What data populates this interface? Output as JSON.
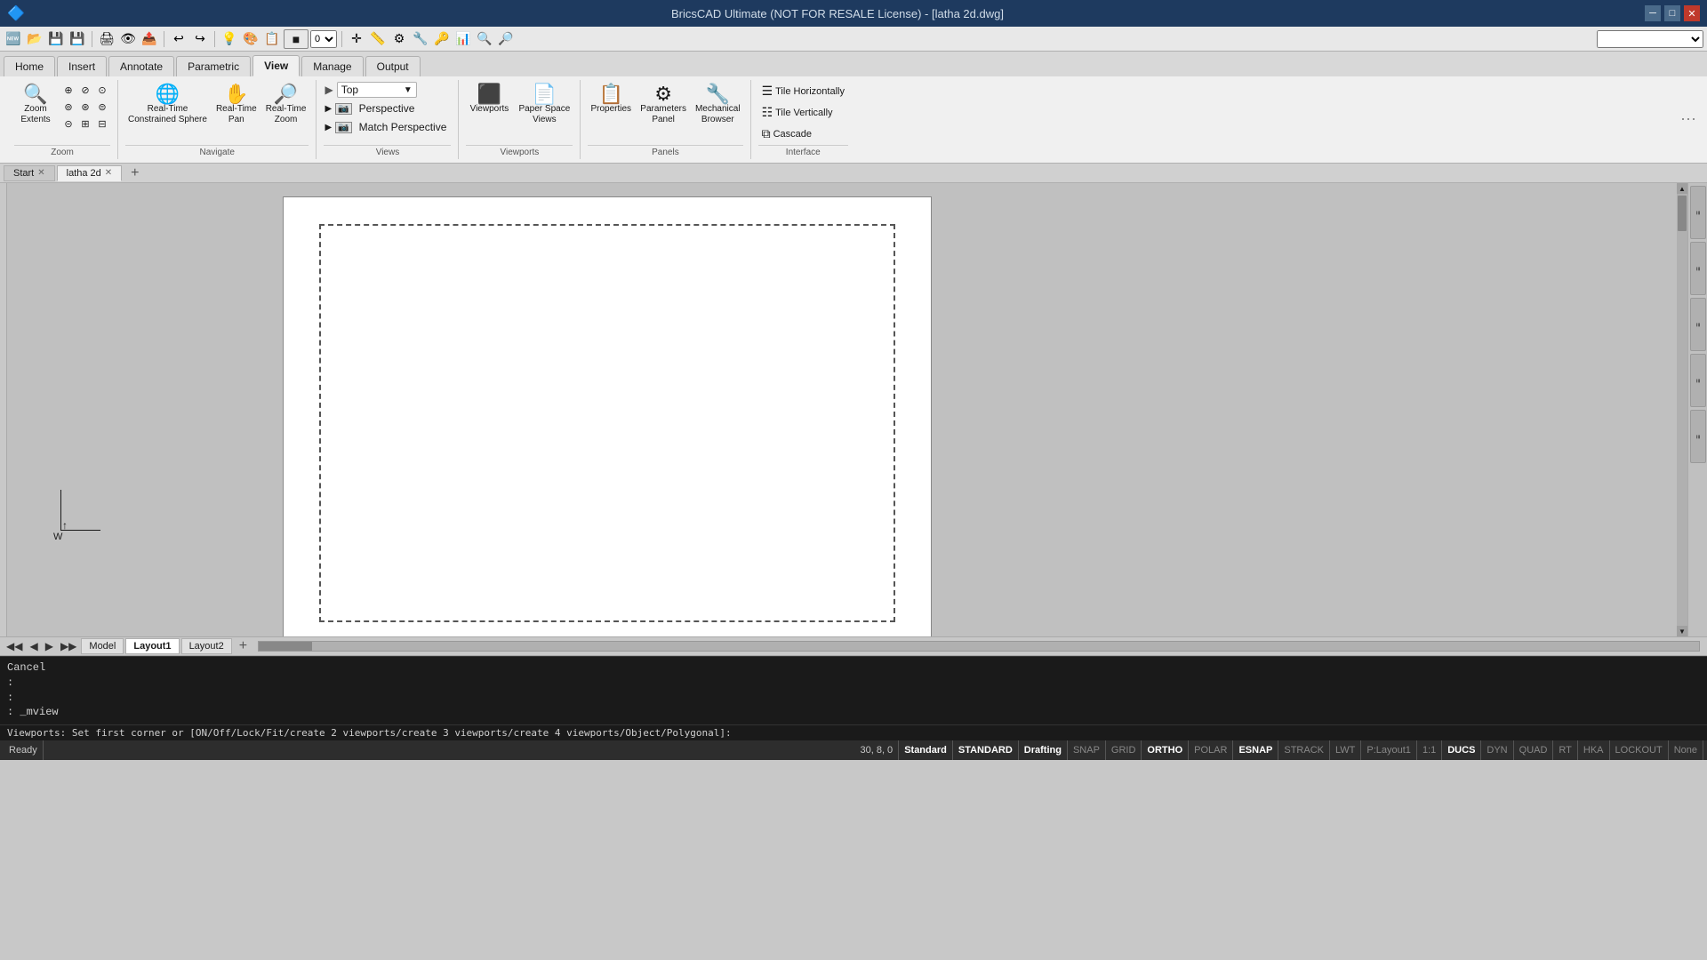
{
  "titleBar": {
    "title": "BricsCAD Ultimate (NOT FOR RESALE License) - [latha 2d.dwg]",
    "winControls": [
      "minimize",
      "restore",
      "close"
    ]
  },
  "ribbon": {
    "tabs": [
      {
        "label": "Home",
        "active": false
      },
      {
        "label": "Insert",
        "active": false
      },
      {
        "label": "Annotate",
        "active": false
      },
      {
        "label": "Parametric",
        "active": false
      },
      {
        "label": "View",
        "active": true
      },
      {
        "label": "Manage",
        "active": false
      },
      {
        "label": "Output",
        "active": false
      }
    ],
    "groups": {
      "zoom": {
        "label": "Zoom",
        "extentsBtn": "Zoom\nExtents",
        "buttons": [
          "⊞",
          "⊟",
          "⊠",
          "⊡",
          "⊢",
          "⊣",
          "⊤",
          "⊥",
          "⊦"
        ]
      },
      "navigate": {
        "label": "Navigate",
        "realTimeConstrained": "Real-Time\nConstrained Sphere",
        "realTimePan": "Real-Time\nPan",
        "realTimeZoom": "Real-Time\nZoom"
      },
      "views": {
        "label": "Views",
        "dropdown": "Top",
        "items": [
          {
            "icon": "🔲",
            "label": "Perspective"
          },
          {
            "icon": "🔳",
            "label": "Match Perspective"
          }
        ]
      },
      "viewports": {
        "label": "Viewports",
        "items": [
          {
            "label": "Viewports"
          },
          {
            "label": "Paper Space\nViews"
          }
        ]
      },
      "panels": {
        "label": "Panels",
        "items": [
          {
            "label": "Properties"
          },
          {
            "label": "Parameters\nPanel"
          },
          {
            "label": "Mechanical\nBrowser"
          }
        ]
      },
      "interface": {
        "label": "Interface",
        "items": [
          {
            "label": "Tile Horizontally"
          },
          {
            "label": "Tile Vertically"
          },
          {
            "label": "Cascade"
          }
        ]
      }
    }
  },
  "docTabs": [
    {
      "label": "Start",
      "closeable": true,
      "active": false
    },
    {
      "label": "latha 2d",
      "closeable": true,
      "active": true
    }
  ],
  "docTabAdd": "+",
  "layoutTabs": {
    "navBtns": [
      "◀◀",
      "◀",
      "▶",
      "▶▶"
    ],
    "tabs": [
      {
        "label": "Model",
        "active": false
      },
      {
        "label": "Layout1",
        "active": true
      },
      {
        "label": "Layout2",
        "active": false
      }
    ],
    "addBtn": "+"
  },
  "commandOutput": [
    {
      "text": "Cancel"
    },
    {
      "text": ":"
    },
    {
      "text": ":"
    },
    {
      "text": ": _mview"
    }
  ],
  "commandPrompt": "Viewports:  Set first corner or [ON/Off/Lock/Fit/create 2 viewports/create 3 viewports/create 4 viewports/Object/Polygonal]:",
  "statusBar": {
    "coords": "30, 8, 0",
    "items": [
      {
        "label": "Standard",
        "active": false
      },
      {
        "label": "STANDARD",
        "active": false
      },
      {
        "label": "Drafting",
        "active": false
      },
      {
        "label": "SNAP",
        "active": false
      },
      {
        "label": "GRID",
        "active": false
      },
      {
        "label": "ORTHO",
        "active": true
      },
      {
        "label": "POLAR",
        "active": false
      },
      {
        "label": "ESNAP",
        "active": true
      },
      {
        "label": "STRACK",
        "active": false
      },
      {
        "label": "LWT",
        "active": false
      },
      {
        "label": "P:Layout1",
        "active": false
      },
      {
        "label": "1:1",
        "active": false
      },
      {
        "label": "DUCS",
        "active": true
      },
      {
        "label": "DYN",
        "active": false
      },
      {
        "label": "QUAD",
        "active": false
      },
      {
        "label": "RT",
        "active": false
      },
      {
        "label": "HKA",
        "active": false
      },
      {
        "label": "LOCKOUT",
        "active": false
      },
      {
        "label": "None",
        "active": false
      }
    ],
    "ready": "Ready"
  },
  "rightPanel": {
    "icons": [
      "≡",
      "≡",
      "≡",
      "≡",
      "≡"
    ]
  }
}
